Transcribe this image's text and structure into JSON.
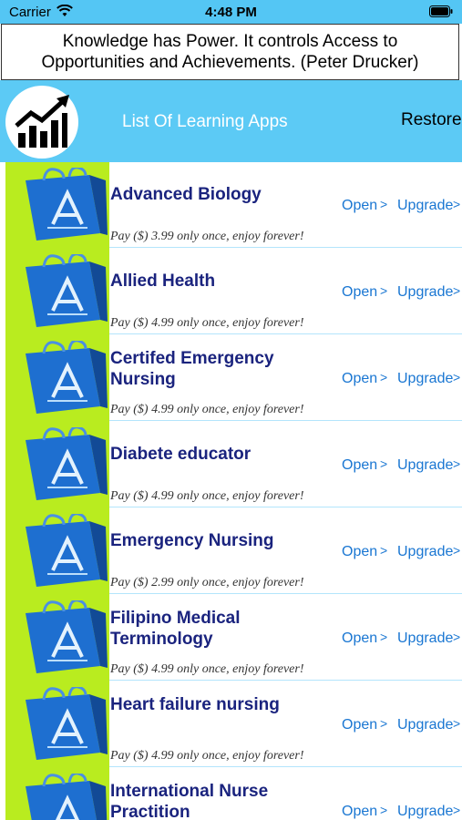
{
  "status_bar": {
    "carrier": "Carrier",
    "time": "4:48 PM"
  },
  "quote": "Knowledge has Power. It controls Access to Opportunities and Achievements. (Peter Drucker)",
  "header": {
    "title": "List Of Learning Apps",
    "restore": "Restore"
  },
  "actions": {
    "open": "Open",
    "upgrade": "Upgrade",
    "chevron": ">"
  },
  "colors": {
    "accent": "#5ccaf5",
    "green_strip": "#b9ec1f",
    "title_text": "#1a237e",
    "link": "#1976d2"
  },
  "apps": [
    {
      "name": "Advanced Biology",
      "price": "Pay ($)  3.99 only once, enjoy forever!"
    },
    {
      "name": "Allied Health",
      "price": "Pay ($)  4.99 only once, enjoy forever!"
    },
    {
      "name": "Certifed Emergency Nursing",
      "price": "Pay ($)  4.99 only once, enjoy forever!"
    },
    {
      "name": "Diabete educator",
      "price": "Pay ($)  4.99 only once, enjoy forever!"
    },
    {
      "name": "Emergency Nursing",
      "price": "Pay ($)  2.99 only once, enjoy forever!"
    },
    {
      "name": "Filipino Medical Terminology",
      "price": "Pay ($)  4.99 only once, enjoy forever!"
    },
    {
      "name": "Heart failure nursing",
      "price": "Pay ($)  4.99 only once, enjoy forever!"
    },
    {
      "name": "International Nurse Practition",
      "price": ""
    }
  ]
}
